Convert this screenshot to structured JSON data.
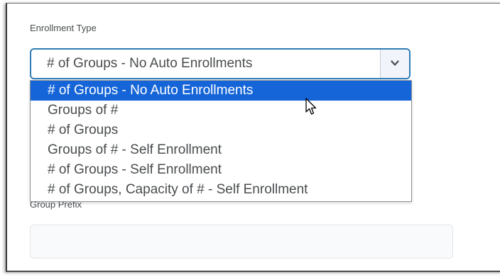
{
  "enrollment": {
    "label": "Enrollment Type",
    "selected_value": "# of Groups - No Auto Enrollments",
    "arrow_icon": "chevron-down-icon",
    "options": [
      {
        "label": "# of Groups - No Auto Enrollments",
        "selected": true
      },
      {
        "label": "Groups of #",
        "selected": false
      },
      {
        "label": "# of Groups",
        "selected": false
      },
      {
        "label": "Groups of # - Self Enrollment",
        "selected": false
      },
      {
        "label": "# of Groups - Self Enrollment",
        "selected": false
      },
      {
        "label": "# of Groups, Capacity of # - Self Enrollment",
        "selected": false
      }
    ]
  },
  "group_prefix": {
    "label": "Group Prefix",
    "value": "",
    "placeholder": ""
  },
  "colors": {
    "focus_border": "#2e7bb5",
    "selected_option_bg": "#1565d8",
    "text": "#494c4e"
  },
  "cursor_icon": "mouse-pointer-icon"
}
